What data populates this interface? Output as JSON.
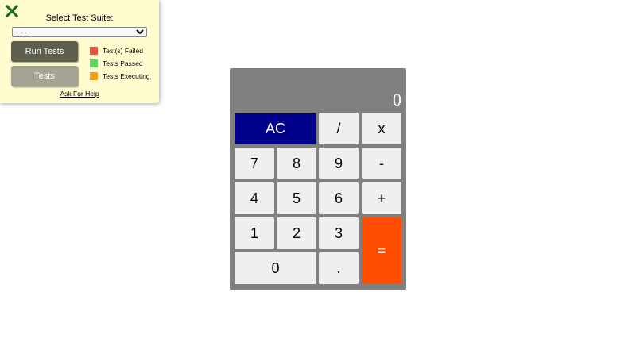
{
  "test_panel": {
    "close_icon": "close-x-icon",
    "suite_title": "Select Test Suite:",
    "suite_select_value": "- - -",
    "run_tests_label": "Run Tests",
    "tests_label": "Tests",
    "legend": [
      {
        "label": "Test(s) Failed",
        "color": "#e8533f"
      },
      {
        "label": "Tests Passed",
        "color": "#5ad85a"
      },
      {
        "label": "Tests Executing",
        "color": "#f5a01a"
      }
    ],
    "help_link": "Ask For Help",
    "colors": {
      "panel_bg": "#fffdd0",
      "close_icon": "#1e6b1e",
      "run_button": "#5e5e4e",
      "tests_button": "#a3a391"
    }
  },
  "calculator": {
    "display": "0",
    "keys": {
      "ac": "AC",
      "divide": "/",
      "multiply": "x",
      "seven": "7",
      "eight": "8",
      "nine": "9",
      "subtract": "-",
      "four": "4",
      "five": "5",
      "six": "6",
      "add": "+",
      "one": "1",
      "two": "2",
      "three": "3",
      "equals": "=",
      "zero": "0",
      "decimal": "."
    },
    "colors": {
      "body": "#808080",
      "ac_key": "#00008b",
      "equals_key": "#ff4d00",
      "digit_key": "#efefef"
    }
  }
}
